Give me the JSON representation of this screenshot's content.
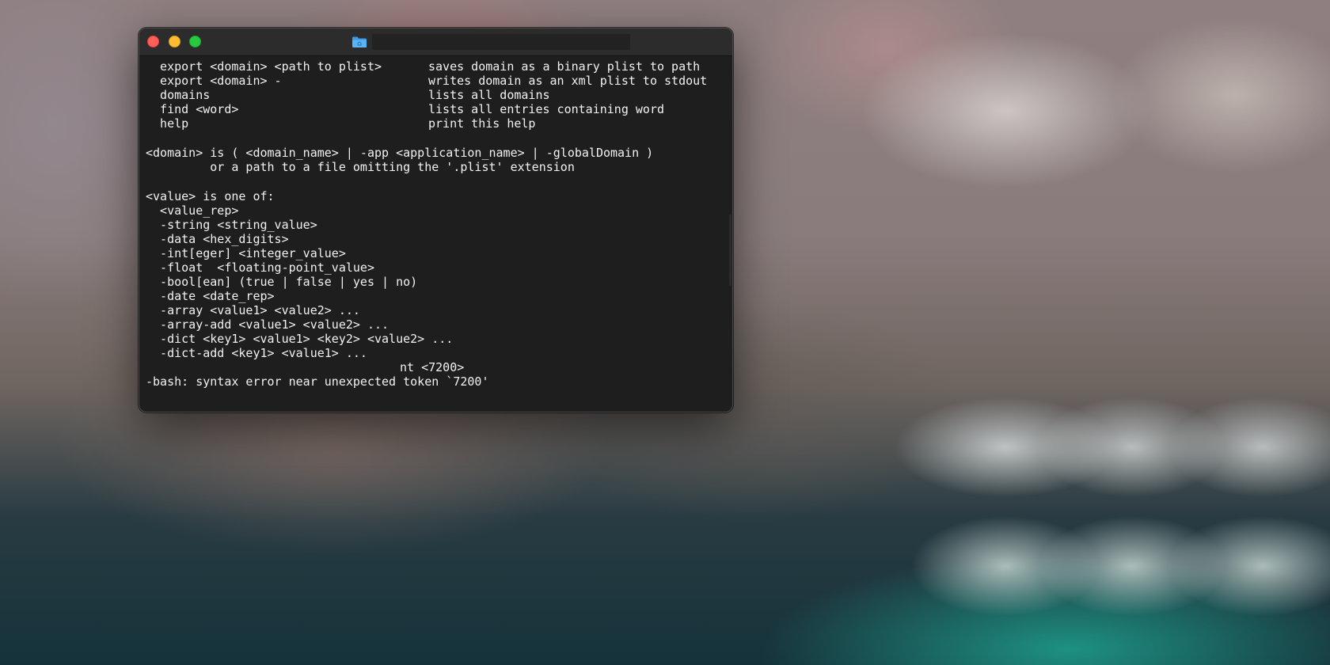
{
  "desktop": {
    "wallpaper": "blurred-photo"
  },
  "window": {
    "app": "Terminal",
    "icon": "folder-icon",
    "title": "",
    "colors": {
      "background": "#1e1e1e",
      "text": "#f2f2f2",
      "close": "#fe5f57",
      "minimize": "#febc2e",
      "zoom": "#28c840"
    }
  },
  "terminal": {
    "commands": [
      {
        "cmd": "  export <domain> <path to plist>",
        "desc": "saves domain as a binary plist to path"
      },
      {
        "cmd": "  export <domain> -",
        "desc": "writes domain as an xml plist to stdout"
      },
      {
        "cmd": "  domains",
        "desc": "lists all domains"
      },
      {
        "cmd": "  find <word>",
        "desc": "lists all entries containing word"
      },
      {
        "cmd": "  help",
        "desc": "print this help"
      }
    ],
    "domain_lines": [
      "<domain> is ( <domain_name> | -app <application_name> | -globalDomain )",
      "         or a path to a file omitting the '.plist' extension"
    ],
    "value_lines": [
      "<value> is one of:",
      "  <value_rep>",
      "  -string <string_value>",
      "  -data <hex_digits>",
      "  -int[eger] <integer_value>",
      "  -float  <floating-point_value>",
      "  -bool[ean] (true | false | yes | no)",
      "  -date <date_rep>",
      "  -array <value1> <value2> ...",
      "  -array-add <value1> <value2> ...",
      "  -dict <key1> <value1> <key2> <value2> ...",
      "  -dict-add <key1> <value1> ..."
    ],
    "partial_line": "nt <7200>",
    "error_line": "-bash: syntax error near unexpected token `7200'"
  }
}
